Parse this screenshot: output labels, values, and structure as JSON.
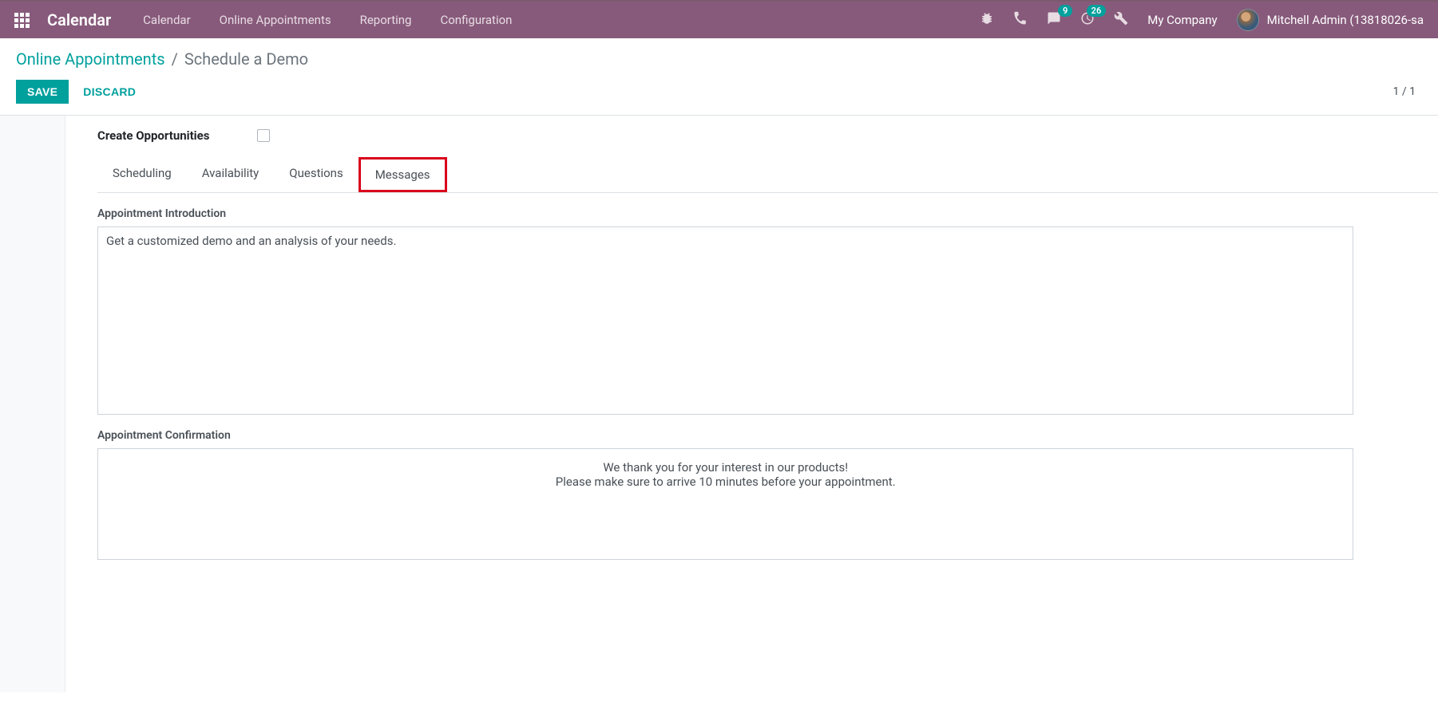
{
  "navbar": {
    "brand": "Calendar",
    "items": [
      "Calendar",
      "Online Appointments",
      "Reporting",
      "Configuration"
    ],
    "badges": {
      "messages": "9",
      "activities": "26"
    },
    "company": "My Company",
    "username": "Mitchell Admin (13818026-sa"
  },
  "breadcrumb": {
    "parent": "Online Appointments",
    "sep": "/",
    "current": "Schedule a Demo"
  },
  "buttons": {
    "save": "SAVE",
    "discard": "DISCARD"
  },
  "pager": "1 / 1",
  "form": {
    "create_opportunities_label": "Create Opportunities"
  },
  "tabs": [
    "Scheduling",
    "Availability",
    "Questions",
    "Messages"
  ],
  "active_tab_index": 3,
  "sections": {
    "intro_label": "Appointment Introduction",
    "intro_text": "Get a customized demo and an analysis of your needs.",
    "confirm_label": "Appointment Confirmation",
    "confirm_line1": "We thank you for your interest in our products!",
    "confirm_line2": "Please make sure to arrive 10 minutes before your appointment."
  }
}
